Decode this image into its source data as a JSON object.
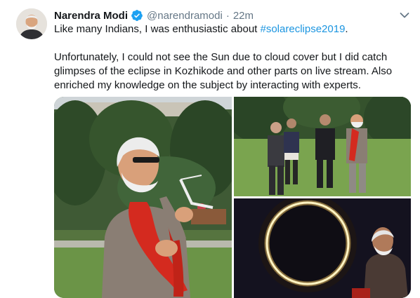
{
  "author": {
    "name": "Narendra Modi",
    "handle": "@narendramodi",
    "time": "22m",
    "verified": true,
    "separator": "·"
  },
  "tweet": {
    "line1_text": "Like many Indians, I was enthusiastic about ",
    "hashtag": "#solareclipse2019",
    "line1_end": ".",
    "paragraph2": "Unfortunately, I could not see the Sun due to cloud cover but I did catch glimpses of the eclipse in Kozhikode and other parts on live stream. Also enriched my knowledge on the subject by interacting with experts."
  },
  "icons": {
    "verified": "verified-badge-icon",
    "menu": "chevron-down-icon"
  },
  "colors": {
    "link": "#1b95e0",
    "verified": "#1da1f2",
    "secondary_text": "#657786",
    "scarf_red": "#d42a1f"
  }
}
